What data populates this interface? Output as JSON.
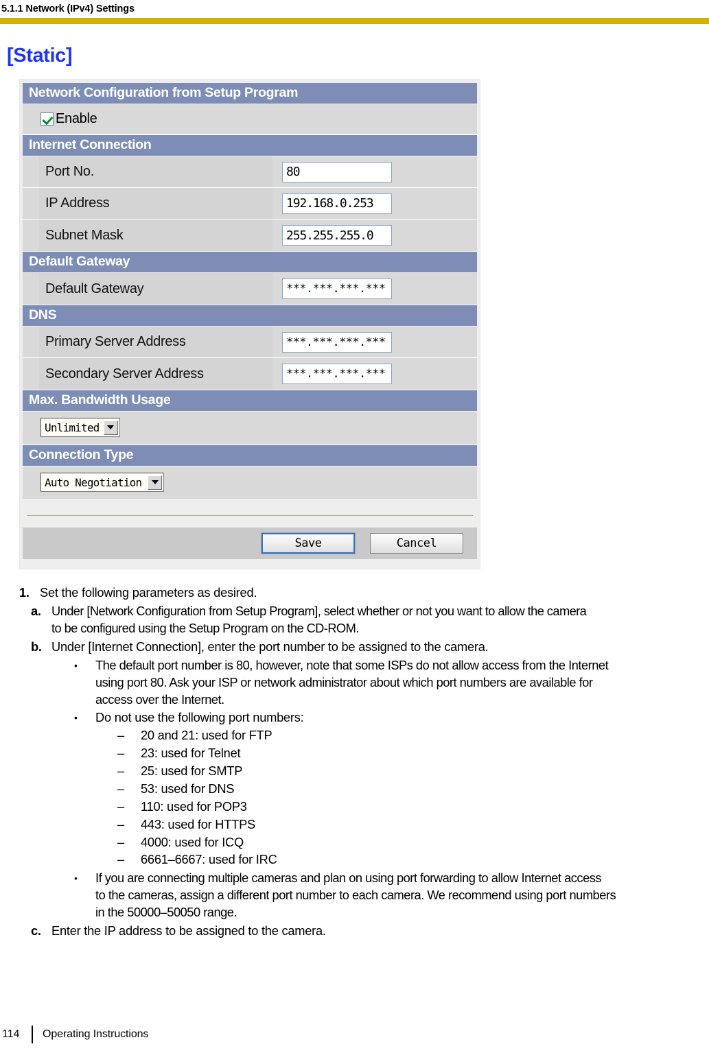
{
  "header": {
    "running_head": "5.1.1 Network (IPv4) Settings",
    "rule_color": "#d6b000"
  },
  "section_heading": "[Static]",
  "screenshot": {
    "accent_color": "#7d8db6",
    "sections": [
      {
        "title": "Network Configuration from Setup Program",
        "checkbox": {
          "label": "Enable",
          "checked": true
        }
      },
      {
        "title": "Internet Connection",
        "fields": [
          {
            "label": "Port No.",
            "value": "80"
          },
          {
            "label": "IP Address",
            "value": "192.168.0.253"
          },
          {
            "label": "Subnet Mask",
            "value": "255.255.255.0"
          }
        ]
      },
      {
        "title": "Default Gateway",
        "fields": [
          {
            "label": "Default Gateway",
            "value": "***.***.***.***"
          }
        ]
      },
      {
        "title": "DNS",
        "fields": [
          {
            "label": "Primary Server Address",
            "value": "***.***.***.***"
          },
          {
            "label": "Secondary Server Address",
            "value": "***.***.***.***"
          }
        ]
      },
      {
        "title": "Max. Bandwidth Usage",
        "dropdown": {
          "value": "Unlimited"
        }
      },
      {
        "title": "Connection Type",
        "dropdown": {
          "value": "Auto Negotiation"
        }
      }
    ],
    "buttons": {
      "save": "Save",
      "cancel": "Cancel"
    }
  },
  "instructions": {
    "step_number": "1.",
    "step_text": "Set the following parameters as desired.",
    "sub_a": {
      "marker": "a.",
      "line1": "Under [Network Configuration from Setup Program], select whether or not you want to allow the camera",
      "line2": "to be configured using the Setup Program on the CD-ROM."
    },
    "sub_b": {
      "marker": "b.",
      "line1": "Under [Internet Connection], enter the port number to be assigned to the camera.",
      "bullet1": {
        "marker": "•",
        "line1": "The default port number is 80, however, note that some ISPs do not allow access from the Internet",
        "line2": "using port 80. Ask your ISP or network administrator about which port numbers are available for",
        "line3": "access over the Internet."
      },
      "bullet2": {
        "marker": "•",
        "text": "Do not use the following port numbers:",
        "ports": [
          {
            "marker": "–",
            "text": "20 and 21: used for FTP"
          },
          {
            "marker": "–",
            "text": "23: used for Telnet"
          },
          {
            "marker": "–",
            "text": "25: used for SMTP"
          },
          {
            "marker": "–",
            "text": "53: used for DNS"
          },
          {
            "marker": "–",
            "text": "110: used for POP3"
          },
          {
            "marker": "–",
            "text": "443: used for HTTPS"
          },
          {
            "marker": "–",
            "text": "4000: used for ICQ"
          },
          {
            "marker": "–",
            "text": "6661–6667: used for IRC"
          }
        ]
      },
      "bullet3": {
        "marker": "•",
        "line1": "If you are connecting multiple cameras and plan on using port forwarding to allow Internet access",
        "line2": "to the cameras, assign a different port number to each camera. We recommend using port numbers",
        "line3": "in the 50000–50050 range."
      }
    },
    "sub_c": {
      "marker": "c.",
      "line1": "Enter the IP address to be assigned to the camera."
    }
  },
  "footer": {
    "page_number": "114",
    "label": "Operating Instructions"
  }
}
